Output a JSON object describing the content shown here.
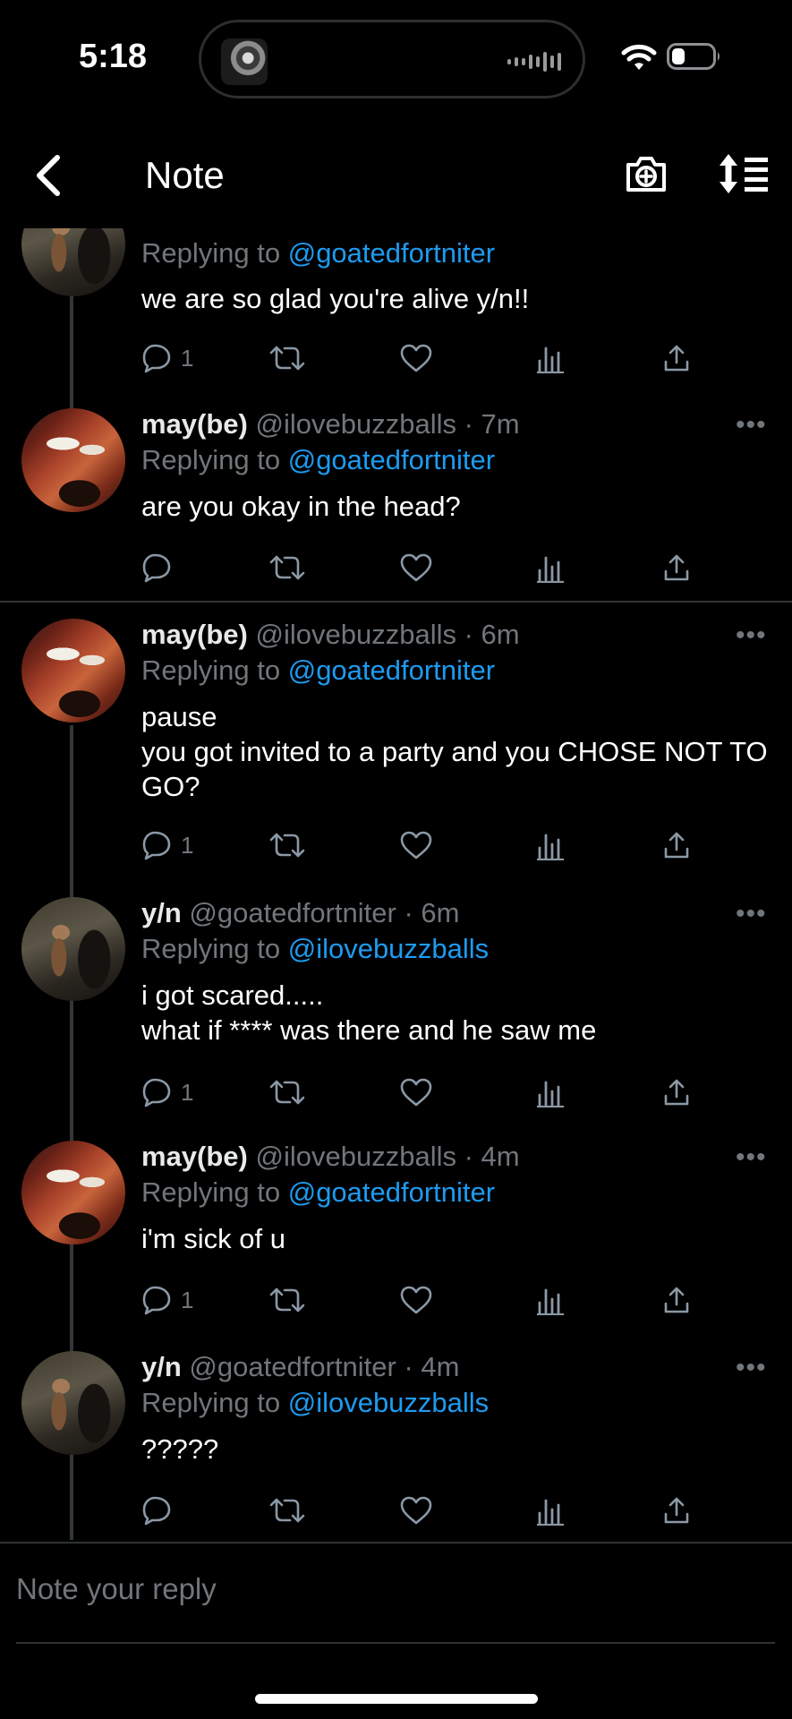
{
  "status_bar": {
    "time": "5:18",
    "icons": [
      "now-playing-artwork",
      "audio-visualizer-icon",
      "wifi-icon",
      "battery-icon"
    ]
  },
  "header": {
    "title": "Note",
    "back_icon": "chevron-left-icon",
    "camera_icon": "camera-plus-icon",
    "sort_icon": "sort-list-icon"
  },
  "posts": [
    {
      "name": "",
      "handle": "",
      "time": "",
      "replying_prefix": "Replying to ",
      "replying_to": "@goatedfortniter",
      "text": "we are so glad you're alive y/n!!",
      "reply_count": "1",
      "avatar": "yn-avatar"
    },
    {
      "name": "may(be)",
      "handle": "@ilovebuzzballs",
      "time": "7m",
      "replying_prefix": "Replying to ",
      "replying_to": "@goatedfortniter",
      "text": "are you okay in the head?",
      "reply_count": "",
      "avatar": "may-avatar"
    },
    {
      "name": "may(be)",
      "handle": "@ilovebuzzballs",
      "time": "6m",
      "replying_prefix": "Replying to ",
      "replying_to": "@goatedfortniter",
      "text": "pause\nyou got invited to a party and you CHOSE NOT TO GO?",
      "reply_count": "1",
      "avatar": "may-avatar"
    },
    {
      "name": "y/n",
      "handle": "@goatedfortniter",
      "time": "6m",
      "replying_prefix": "Replying to ",
      "replying_to": "@ilovebuzzballs",
      "text": "i got scared.....\nwhat if **** was there and he saw me",
      "reply_count": "1",
      "avatar": "yn-avatar"
    },
    {
      "name": "may(be)",
      "handle": "@ilovebuzzballs",
      "time": "4m",
      "replying_prefix": "Replying to ",
      "replying_to": "@goatedfortniter",
      "text": "i'm sick of u",
      "reply_count": "1",
      "avatar": "may-avatar"
    },
    {
      "name": "y/n",
      "handle": "@goatedfortniter",
      "time": "4m",
      "replying_prefix": "Replying to ",
      "replying_to": "@ilovebuzzballs",
      "text": "?????",
      "reply_count": "",
      "avatar": "yn-avatar"
    }
  ],
  "action_icons": [
    "reply-icon",
    "retweet-icon",
    "like-icon",
    "views-icon",
    "share-icon"
  ],
  "reply_bar": {
    "placeholder": "Note your reply"
  },
  "colors": {
    "background": "#000000",
    "text": "#e7e9ea",
    "muted": "#71767b",
    "link": "#1d9bf0",
    "divider": "#2f3336"
  }
}
